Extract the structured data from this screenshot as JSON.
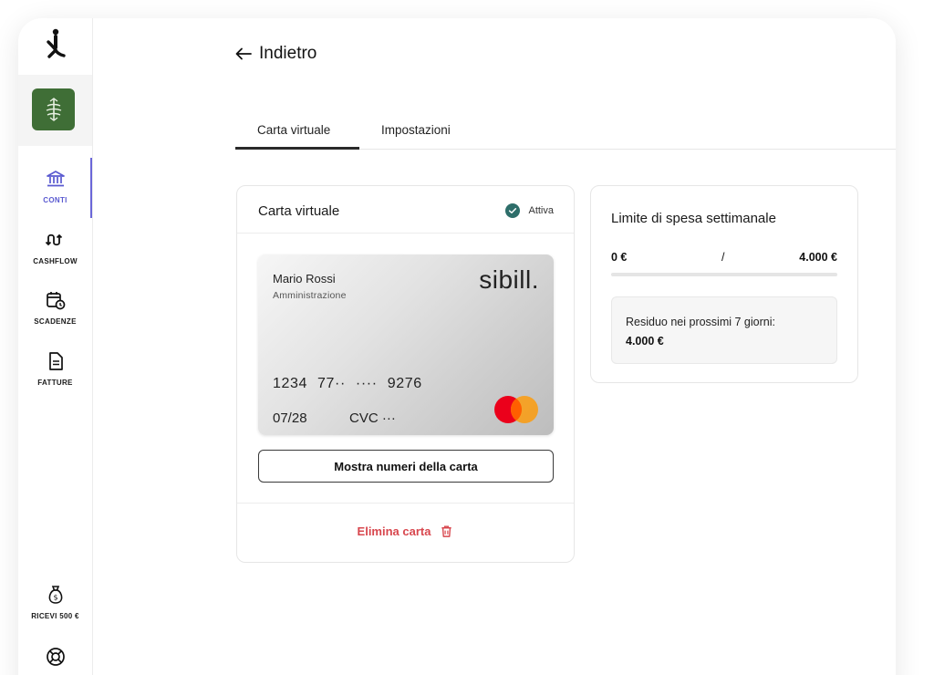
{
  "app": {
    "brand": "sibill."
  },
  "nav": {
    "back_label": "Indietro",
    "items": [
      {
        "label": "CONTI",
        "icon": "bank-icon",
        "active": true
      },
      {
        "label": "CASHFLOW",
        "icon": "cashflow-icon",
        "active": false
      },
      {
        "label": "SCADENZE",
        "icon": "calendar-clock-icon",
        "active": false
      },
      {
        "label": "FATTURE",
        "icon": "invoice-icon",
        "active": false
      },
      {
        "label": "RICEVI 500 €",
        "icon": "money-bag-icon",
        "active": false
      },
      {
        "label": "",
        "icon": "lifebuoy-icon",
        "active": false
      }
    ]
  },
  "tabs": [
    {
      "label": "Carta virtuale",
      "active": true
    },
    {
      "label": "Impostazioni",
      "active": false
    }
  ],
  "card_panel": {
    "title": "Carta virtuale",
    "status": "Attiva",
    "card": {
      "holder": "Mario Rossi",
      "department": "Amministrazione",
      "brand": "sibill.",
      "number": "1234  77··  ····  9276",
      "expiry": "07/28",
      "cvc": "CVC ···",
      "network_icon": "mastercard-icon"
    },
    "show_numbers_label": "Mostra numeri  della carta",
    "delete_label": "Elimina carta"
  },
  "limit_panel": {
    "title": "Limite di spesa settimanale",
    "spent": "0 €",
    "separator": "/",
    "limit": "4.000 €",
    "progress_fraction": 0,
    "remaining_label": "Residuo nei prossimi 7 giorni:",
    "remaining_value": "4.000 €"
  },
  "colors": {
    "accent": "#6a66d8",
    "org_avatar": "#3f6e36",
    "status_ok": "#2e6e6a",
    "danger": "#d8474e",
    "mastercard_red": "#eb001b",
    "mastercard_orange": "#f79e1b"
  }
}
